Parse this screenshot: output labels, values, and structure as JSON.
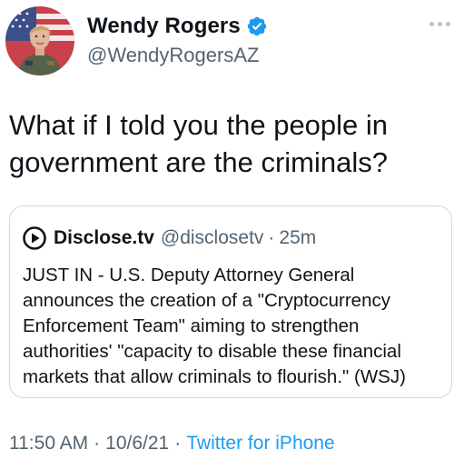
{
  "author": {
    "display_name": "Wendy Rogers",
    "handle": "@WendyRogersAZ",
    "verified_icon": "verified-badge-icon",
    "avatar_icon": "profile-photo"
  },
  "tweet": {
    "text": "What if I told you the people in\ngovernment are the criminals?",
    "time": "11:50 AM",
    "date": "10/6/21",
    "source": "Twitter for iPhone",
    "separator": "·"
  },
  "quote": {
    "name": "Disclose.tv",
    "handle": "@disclosetv",
    "separator": "·",
    "age": "25m",
    "text": "JUST IN - U.S. Deputy Attorney General\nannounces the creation of a \"Cryptocurrency\nEnforcement Team\" aiming to strengthen\nauthorities' \"capacity to disable these financial\nmarkets that allow criminals to flourish.\" (WSJ)"
  },
  "colors": {
    "link": "#1d9bf0",
    "secondary_text": "#536471",
    "border": "#cfd9de",
    "verified": "#1d9bf0"
  }
}
